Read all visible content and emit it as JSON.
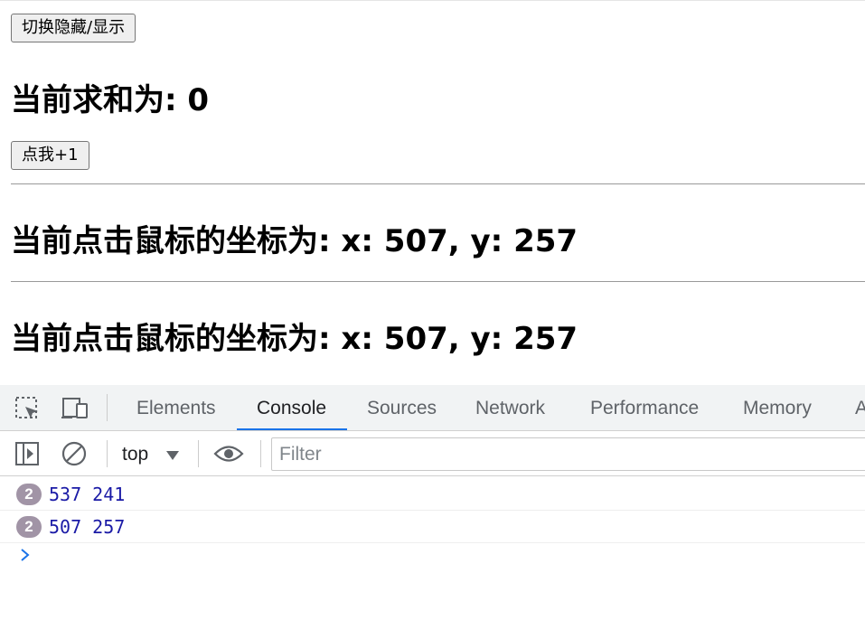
{
  "page": {
    "toggle_button": "切换隐藏/显示",
    "sum_heading": "当前求和为: 0",
    "increment_button": "点我+1",
    "coord_heading_1": "当前点击鼠标的坐标为: x: 507, y: 257",
    "coord_heading_2": "当前点击鼠标的坐标为: x: 507, y: 257"
  },
  "devtools": {
    "tabs": [
      "Elements",
      "Console",
      "Sources",
      "Network",
      "Performance",
      "Memory",
      "A"
    ],
    "active_tab": "Console",
    "context": "top",
    "filter_placeholder": "Filter",
    "logs": [
      {
        "count": "2",
        "text": "537 241"
      },
      {
        "count": "2",
        "text": "507 257"
      }
    ],
    "accent_color": "#1a73e8",
    "badge_color": "#a194a6",
    "log_text_color": "#1a1aa6"
  }
}
